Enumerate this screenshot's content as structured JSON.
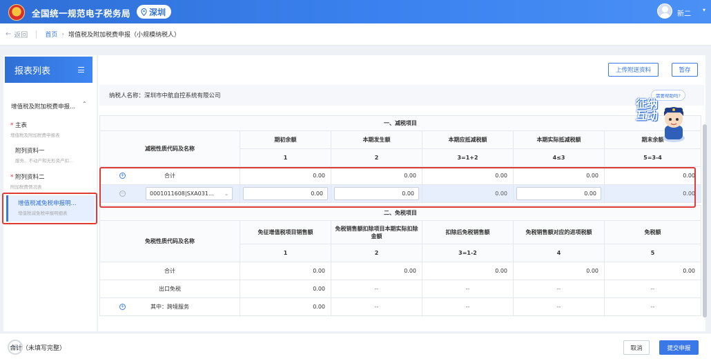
{
  "header": {
    "site_title": "全国统一规范电子税务局",
    "city": "深圳",
    "user_name": "新二"
  },
  "breadcrumb": {
    "back": "返回",
    "home": "首页",
    "current": "增值税及附加税费申报（小规模纳税人）"
  },
  "sidebar": {
    "title": "报表列表",
    "group": "增值税及附加税费申报...",
    "items": [
      {
        "label": "主表",
        "sub": "增值税及附加税费申报表",
        "required": true
      },
      {
        "label": "附列资料一",
        "sub": "服务、不动产和无形资产扣...",
        "required": false
      },
      {
        "label": "附列资料二",
        "sub": "附加税费情况表",
        "required": true
      },
      {
        "label": "增值税减免税申报明...",
        "sub": "增值税减免税申报明细表",
        "required": false
      }
    ]
  },
  "toolbar": {
    "upload_label": "上传附送资料",
    "save_label": "暂存"
  },
  "taxpayer": {
    "label": "纳税人名称：深圳市中航自控系统有限公司"
  },
  "reduction": {
    "section_title": "一、减税项目",
    "code_header": "减税性质代码及名称",
    "columns": [
      "期初余额",
      "本期发生额",
      "本期应抵减税额",
      "本期实际抵减税额",
      "期末余额"
    ],
    "col_numbers": [
      "1",
      "2",
      "3=1+2",
      "4≤3",
      "5=3-4"
    ],
    "total_label": "合计",
    "total_values": [
      "0.00",
      "0.00",
      "0.00",
      "0.00",
      "0.00"
    ],
    "row_code": "0001011608|SXA031...",
    "row_values": [
      "0.00",
      "0.00",
      "0.00",
      "0.00",
      "0.00"
    ]
  },
  "exemption": {
    "section_title": "二、免税项目",
    "code_header": "免税性质代码及名称",
    "columns": [
      "免征增值税项目销售额",
      "免税销售额扣除项目本期实际扣除金额",
      "扣除后免税销售额",
      "免税销售额对应的进项税额",
      "免税额"
    ],
    "col_numbers": [
      "1",
      "2",
      "3=1-2",
      "4",
      "5"
    ],
    "total_label": "合计",
    "total_values": [
      "0.00",
      "0.00",
      "0.00",
      "0.00",
      "0.00"
    ],
    "export_label": "出口免税",
    "export_values": [
      "0.00",
      "--",
      "--",
      "--",
      "--"
    ],
    "cross_label": "其中：跨境服务",
    "cross_values": [
      "0.00",
      "--",
      "--",
      "--",
      "--"
    ]
  },
  "helper": {
    "bubble": "需要帮助吗?",
    "text": "征纳互动"
  },
  "footer": {
    "note": "合计（未填写完整）",
    "cancel_label": "取消",
    "submit_label": "提交申报"
  },
  "colors": {
    "brand": "#3a78e8",
    "highlight_border": "#e03a34"
  }
}
